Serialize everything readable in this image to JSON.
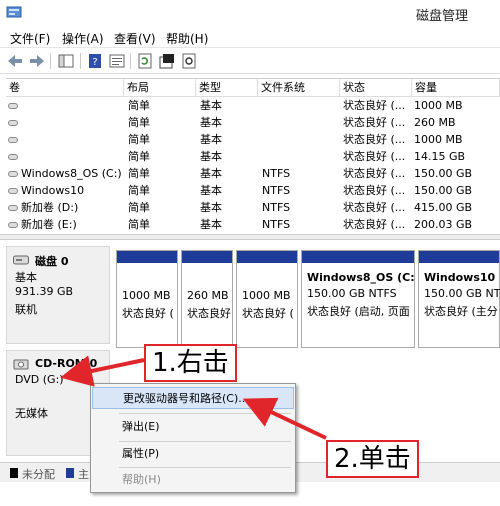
{
  "window": {
    "title": "磁盘管理"
  },
  "menu": [
    {
      "label": "文件(F)"
    },
    {
      "label": "操作(A)"
    },
    {
      "label": "查看(V)"
    },
    {
      "label": "帮助(H)"
    }
  ],
  "volume_table": {
    "columns": [
      "卷",
      "布局",
      "类型",
      "文件系统",
      "状态",
      "容量"
    ],
    "rows": [
      {
        "name": "",
        "layout": "简单",
        "type": "基本",
        "fs": "",
        "status": "状态良好 (...",
        "capacity": "1000 MB"
      },
      {
        "name": "",
        "layout": "简单",
        "type": "基本",
        "fs": "",
        "status": "状态良好 (...",
        "capacity": "260 MB"
      },
      {
        "name": "",
        "layout": "简单",
        "type": "基本",
        "fs": "",
        "status": "状态良好 (...",
        "capacity": "1000 MB"
      },
      {
        "name": "",
        "layout": "简单",
        "type": "基本",
        "fs": "",
        "status": "状态良好 (...",
        "capacity": "14.15 GB"
      },
      {
        "name": "Windows8_OS (C:)",
        "layout": "简单",
        "type": "基本",
        "fs": "NTFS",
        "status": "状态良好 (...",
        "capacity": "150.00 GB"
      },
      {
        "name": "Windows10",
        "layout": "简单",
        "type": "基本",
        "fs": "NTFS",
        "status": "状态良好 (...",
        "capacity": "150.00 GB"
      },
      {
        "name": "新加卷 (D:)",
        "layout": "简单",
        "type": "基本",
        "fs": "NTFS",
        "status": "状态良好 (...",
        "capacity": "415.00 GB"
      },
      {
        "name": "新加卷 (E:)",
        "layout": "简单",
        "type": "基本",
        "fs": "NTFS",
        "status": "状态良好 (...",
        "capacity": "200.03 GB"
      }
    ]
  },
  "disk0": {
    "title": "磁盘 0",
    "type": "基本",
    "size": "931.39 GB",
    "state": "联机",
    "partitions": [
      {
        "line1": "",
        "line2": "1000 MB",
        "line3": "状态良好 ("
      },
      {
        "line1": "",
        "line2": "260 MB",
        "line3": "状态良好"
      },
      {
        "line1": "",
        "line2": "1000 MB",
        "line3": "状态良好 ("
      },
      {
        "line1": "",
        "line2": "",
        "line3": ""
      },
      {
        "line1": "Windows8_OS (C:",
        "line2": "150.00 GB NTFS",
        "line3": "状态良好 (启动, 页面"
      },
      {
        "line1": "Windows10",
        "line2": "150.00 GB NTFS",
        "line3": "状态良好 (主分"
      }
    ]
  },
  "cdrom": {
    "title": "CD-ROM 0",
    "drive": "DVD (G:)",
    "media": "无媒体"
  },
  "status_legend": [
    {
      "label": "未分配",
      "color": "#000000"
    },
    {
      "label": "主",
      "color": "#1f3c99"
    }
  ],
  "context_menu": {
    "items": [
      {
        "label": "更改驱动器号和路径(C)..."
      },
      {
        "label": "弹出(E)"
      },
      {
        "label": "属性(P)"
      },
      {
        "label": "帮助(H)"
      }
    ]
  },
  "annotations": {
    "step1": "1.右击",
    "step2": "2.单击"
  },
  "colors": {
    "partition_bar": "#1f3c99",
    "annotation_red": "#e0262a",
    "menu_highlight": "#d8e6f7"
  }
}
